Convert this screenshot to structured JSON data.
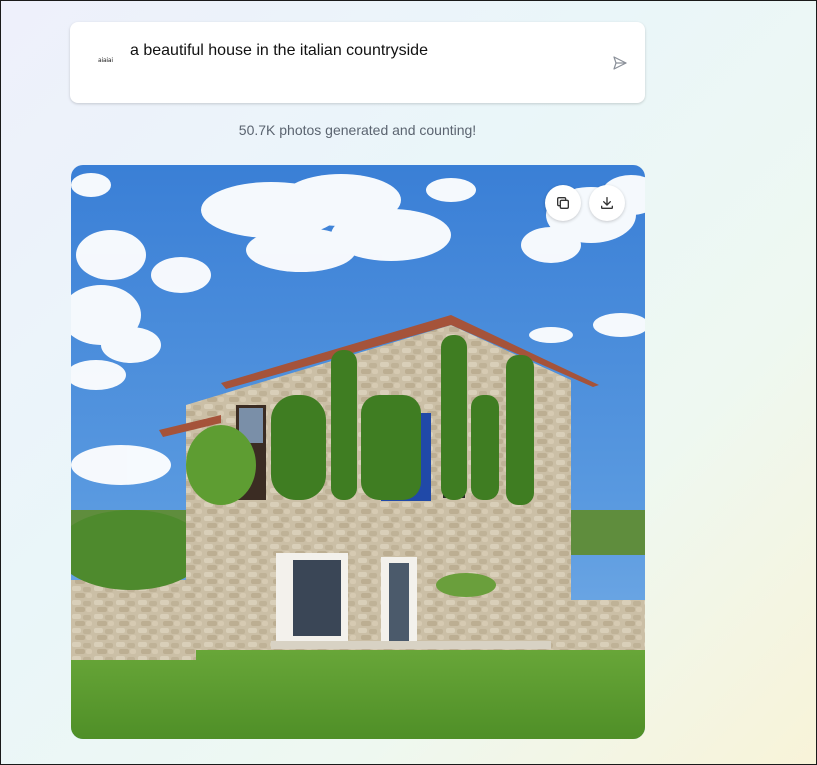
{
  "prompt": {
    "logo_text": "aiaiai",
    "text": "a beautiful house in the italian countryside",
    "send_icon": "send-icon"
  },
  "counter_text": "50.7K photos generated and counting!",
  "image": {
    "alt": "Generated image: stone house in Italian countryside with ivy shaped like letters",
    "actions": [
      {
        "name": "copy",
        "icon": "copy-icon"
      },
      {
        "name": "download",
        "icon": "download-icon"
      }
    ]
  }
}
